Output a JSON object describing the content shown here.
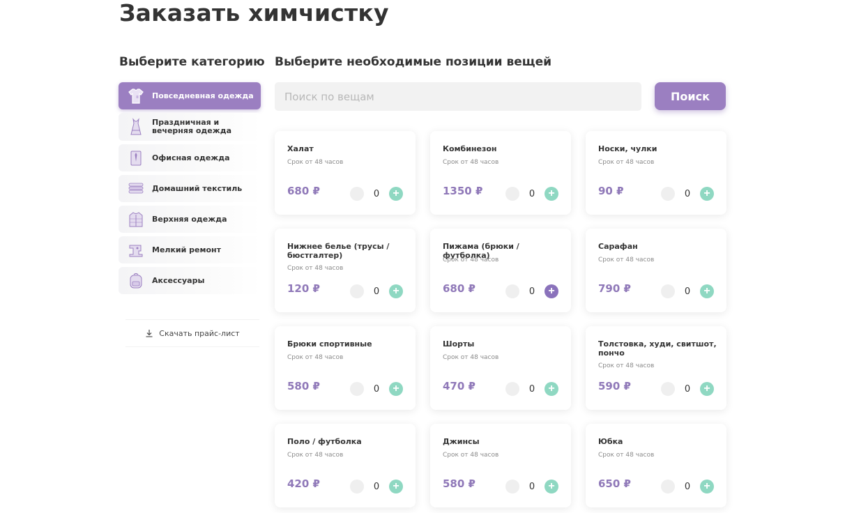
{
  "page": {
    "title": "Заказать химчистку"
  },
  "categories_section": {
    "title": "Выберите категорию"
  },
  "items_section": {
    "title": "Выберите необходимые позиции вещей"
  },
  "sidebar": {
    "items": [
      {
        "label": "Повседневная одежда",
        "icon": "tshirt-icon",
        "active": true
      },
      {
        "label": "Праздничная и вечерняя одежда",
        "icon": "dress-icon",
        "active": false
      },
      {
        "label": "Офисная одежда",
        "icon": "shirt-tie-icon",
        "active": false
      },
      {
        "label": "Домашний текстиль",
        "icon": "towels-icon",
        "active": false
      },
      {
        "label": "Верхняя одежда",
        "icon": "jacket-icon",
        "active": false
      },
      {
        "label": "Мелкий ремонт",
        "icon": "sewing-machine-icon",
        "active": false
      },
      {
        "label": "Аксессуары",
        "icon": "backpack-icon",
        "active": false
      }
    ],
    "download_label": "Скачать прайс-лист"
  },
  "search": {
    "placeholder": "Поиск по вещам",
    "value": "",
    "button_label": "Поиск"
  },
  "colors": {
    "accent": "#9b7fc1",
    "price": "#8f78b8",
    "plus": "#8fd8c2"
  },
  "cards": [
    {
      "name": "Халат",
      "term": "Срок от 48 часов",
      "price": "680 ₽",
      "qty": "0"
    },
    {
      "name": "Комбинезон",
      "term": "Срок от 48 часов",
      "price": "1350 ₽",
      "qty": "0"
    },
    {
      "name": "Носки, чулки",
      "term": "Срок от 48 часов",
      "price": "90 ₽",
      "qty": "0"
    },
    {
      "name": "Нижнее белье (трусы / бюстгалтер)",
      "term": "Срок от 48 часов",
      "price": "120 ₽",
      "qty": "0"
    },
    {
      "name": "Пижама (брюки / футболка)",
      "term": "Срок от 48 часов",
      "price": "680 ₽",
      "qty": "0"
    },
    {
      "name": "Сарафан",
      "term": "Срок от 48 часов",
      "price": "790 ₽",
      "qty": "0"
    },
    {
      "name": "Брюки спортивные",
      "term": "Срок от 48 часов",
      "price": "580 ₽",
      "qty": "0"
    },
    {
      "name": "Шорты",
      "term": "Срок от 48 часов",
      "price": "470 ₽",
      "qty": "0"
    },
    {
      "name": "Толстовка, худи, свитшот, пончо",
      "term": "Срок от 48 часов",
      "price": "590 ₽",
      "qty": "0"
    },
    {
      "name": "Поло / футболка",
      "term": "Срок от 48 часов",
      "price": "420 ₽",
      "qty": "0"
    },
    {
      "name": "Джинсы",
      "term": "Срок от 48 часов",
      "price": "580 ₽",
      "qty": "0"
    },
    {
      "name": "Юбка",
      "term": "Срок от 48 часов",
      "price": "650 ₽",
      "qty": "0"
    }
  ]
}
